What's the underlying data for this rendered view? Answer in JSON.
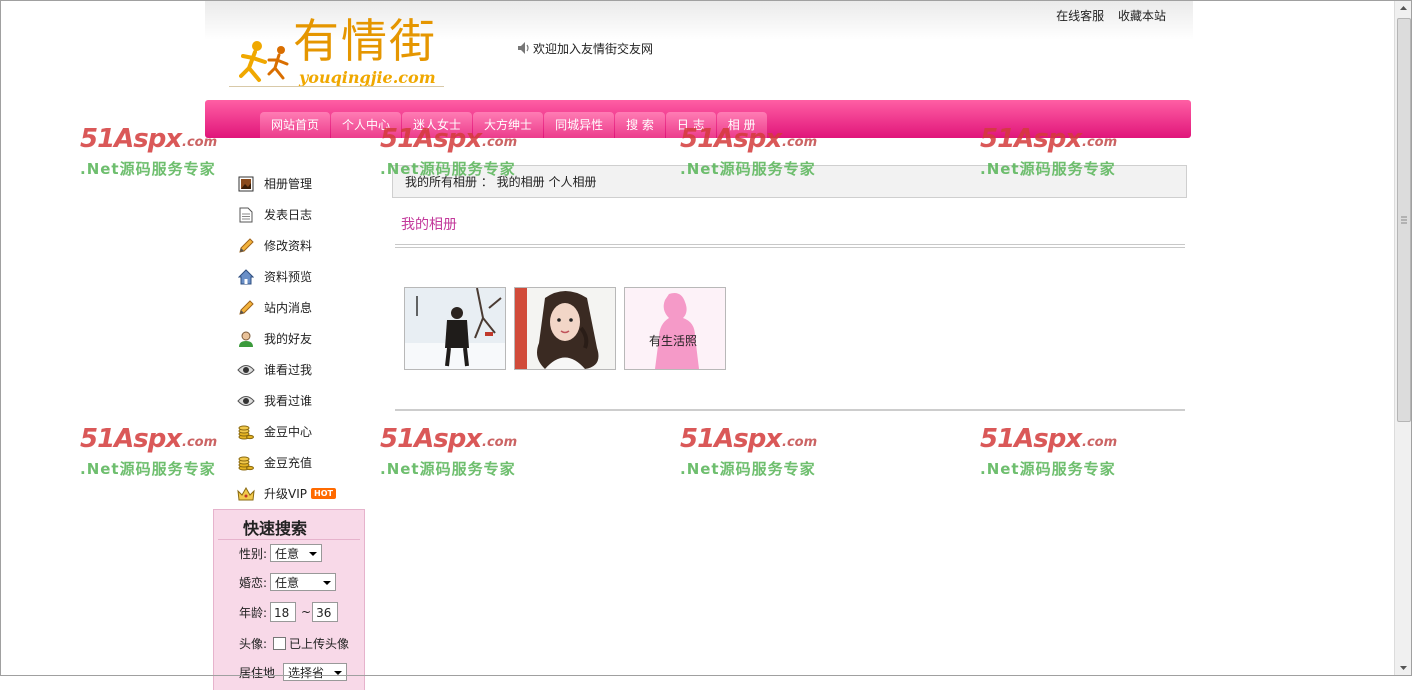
{
  "header": {
    "logo_text": "有情街",
    "logo_sub": "youqingjie.com",
    "top_links": [
      "在线客服",
      "收藏本站"
    ],
    "welcome": "欢迎加入友情街交友网"
  },
  "nav": [
    "网站首页",
    "个人中心",
    "迷人女士",
    "大方绅士",
    "同城异性",
    "搜 索",
    "日 志",
    "相 册"
  ],
  "sidebar": {
    "items": [
      {
        "label": "相册管理",
        "icon": "photo-album-icon"
      },
      {
        "label": "发表日志",
        "icon": "document-icon"
      },
      {
        "label": "修改资料",
        "icon": "pencil-icon"
      },
      {
        "label": "资料预览",
        "icon": "home-icon"
      },
      {
        "label": "站内消息",
        "icon": "pencil-icon"
      },
      {
        "label": "我的好友",
        "icon": "user-icon"
      },
      {
        "label": "谁看过我",
        "icon": "eye-icon"
      },
      {
        "label": "我看过谁",
        "icon": "eye-icon"
      },
      {
        "label": "金豆中心",
        "icon": "coins-icon"
      },
      {
        "label": "金豆充值",
        "icon": "coins-icon"
      },
      {
        "label": "升级VIP",
        "icon": "crown-icon"
      }
    ],
    "hot_badge": "HOT"
  },
  "quick_search": {
    "title": "快速搜索",
    "gender_label": "性别:",
    "gender_value": "任意",
    "marital_label": "婚恋:",
    "marital_value": "任意",
    "age_label": "年龄:",
    "age_from": "18",
    "age_sep": "~",
    "age_to": "36",
    "avatar_label": "头像:",
    "avatar_check_label": "已上传头像",
    "residence_label": "居住地",
    "residence_value": "选择省"
  },
  "breadcrumb": "我的所有相册 ： 我的相册 个人相册",
  "album": {
    "title": "我的相册",
    "photos": [
      {
        "name": "photo-man-snow"
      },
      {
        "name": "photo-woman-portrait"
      },
      {
        "name": "photo-placeholder",
        "caption": "有生活照"
      }
    ]
  },
  "watermark": {
    "brand": "51Aspx",
    "brand_suffix": ".com",
    "slogan": ".Net源码服务专家"
  },
  "colors": {
    "nav_pink": "#e0157a",
    "accent_magenta": "#c3399b",
    "quick_search_bg": "#f8d9e8"
  }
}
